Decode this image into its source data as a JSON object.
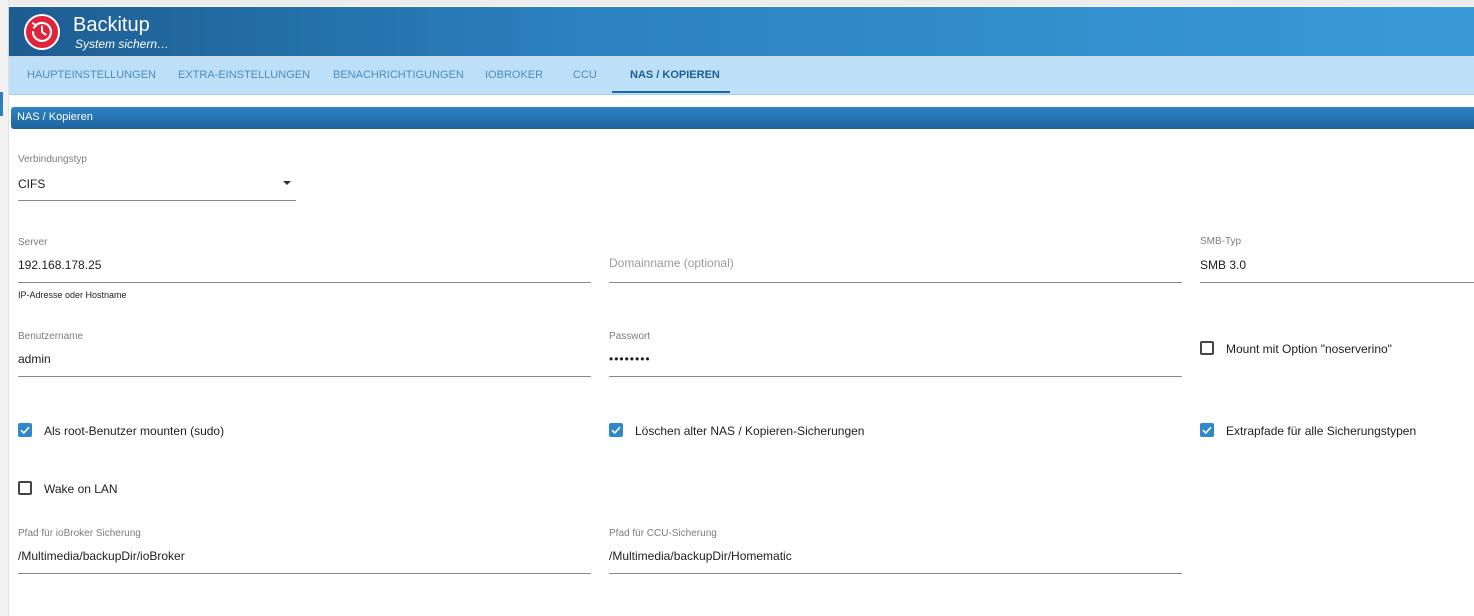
{
  "app": {
    "title": "Backitup",
    "subtitle": "System sichern…",
    "icon": "backup-clock-icon",
    "accent_color": "#e2223a"
  },
  "tabs": [
    {
      "label": "HAUPTEINSTELLUNGEN",
      "active": false
    },
    {
      "label": "EXTRA-EINSTELLUNGEN",
      "active": false
    },
    {
      "label": "BENACHRICHTIGUNGEN",
      "active": false
    },
    {
      "label": "IOBROKER",
      "active": false
    },
    {
      "label": "CCU",
      "active": false
    },
    {
      "label": "NAS / KOPIEREN",
      "active": true
    }
  ],
  "section": {
    "title": "NAS / Kopieren"
  },
  "fields": {
    "connection_type": {
      "label": "Verbindungstyp",
      "value": "CIFS",
      "icon": "dropdown-arrow-icon"
    },
    "server": {
      "label": "Server",
      "value": "192.168.178.25",
      "help": "IP-Adresse oder Hostname"
    },
    "domain": {
      "placeholder": "Domainname (optional)",
      "value": ""
    },
    "smb_type": {
      "label": "SMB-Typ",
      "value": "SMB 3.0"
    },
    "username": {
      "label": "Benutzername",
      "value": "admin"
    },
    "password": {
      "label": "Passwort",
      "value": "••••••••"
    },
    "iobroker_path": {
      "label": "Pfad für ioBroker Sicherung",
      "value": "/Multimedia/backupDir/ioBroker"
    },
    "ccu_path": {
      "label": "Pfad für CCU-Sicherung",
      "value": "/Multimedia/backupDir/Homematic"
    }
  },
  "checkboxes": {
    "noserverino": {
      "label": "Mount mit Option \"noserverino\"",
      "checked": false
    },
    "sudo": {
      "label": "Als root-Benutzer mounten (sudo)",
      "checked": true
    },
    "delete_old": {
      "label": "Löschen alter NAS / Kopieren-Sicherungen",
      "checked": true
    },
    "extra_paths": {
      "label": "Extrapfade für alle Sicherungstypen",
      "checked": true
    },
    "wake_on_lan": {
      "label": "Wake on LAN",
      "checked": false
    }
  },
  "colors": {
    "header_start": "#1d5d91",
    "header_end": "#3a9ad8",
    "tabs_bg": "#bde0f8",
    "checkbox_checked": "#2f87cc"
  }
}
